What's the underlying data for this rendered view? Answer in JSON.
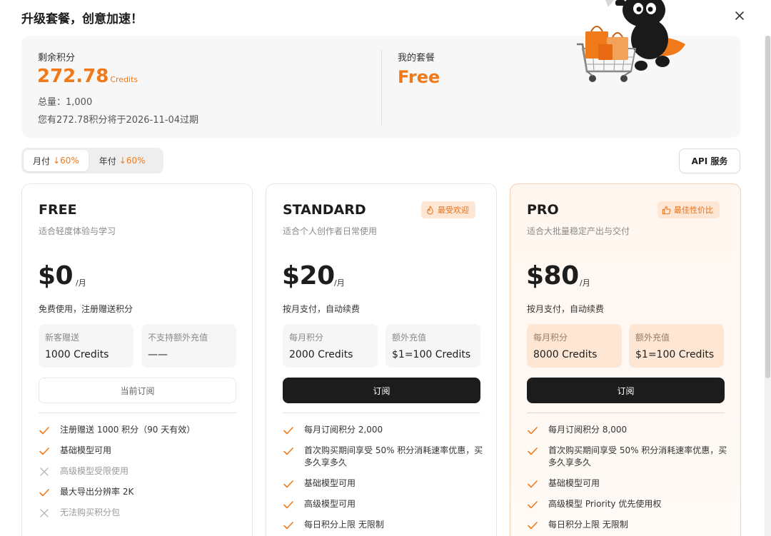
{
  "modal": {
    "title": "升级套餐，创意加速！"
  },
  "summary": {
    "remaining_label": "剩余积分",
    "remaining_value": "272.78",
    "remaining_unit": "Credits",
    "total": "总量：1,000",
    "expire": "您有272.78积分将于2026-11-04过期",
    "plan_label": "我的套餐",
    "plan_value": "Free"
  },
  "billing": {
    "options": [
      {
        "label": "月付",
        "discount": "↓60%",
        "active": true
      },
      {
        "label": "年付",
        "discount": "↓60%",
        "active": false
      }
    ]
  },
  "api_button": "API 服务",
  "colors": {
    "accent": "#f07a1a",
    "dark_button": "#1c1c1c",
    "badge_bg": "#fde6d3"
  },
  "plans": [
    {
      "name": "FREE",
      "subtitle": "适合轻度体验与学习",
      "price": "$0",
      "period": "/月",
      "pay_desc": "免费使用，注册赠送积分",
      "boxes": [
        {
          "label": "新客赠送",
          "value": "1000 Credits"
        },
        {
          "label": "不支持额外充值",
          "value": "——"
        }
      ],
      "cta": "当前订阅",
      "features": [
        {
          "text": "注册赠送 1000 积分（90 天有效）",
          "enabled": true
        },
        {
          "text": "基础模型可用",
          "enabled": true
        },
        {
          "text": "高级模型受限使用",
          "enabled": false
        },
        {
          "text": "最大导出分辨率 2K",
          "enabled": true
        },
        {
          "text": "无法购买积分包",
          "enabled": false
        }
      ]
    },
    {
      "name": "STANDARD",
      "subtitle": "适合个人创作者日常使用",
      "badge": "最受欢迎",
      "badge_icon": "flame-icon",
      "price": "$20",
      "period": "/月",
      "pay_desc": "按月支付，自动续费",
      "boxes": [
        {
          "label": "每月积分",
          "value": "2000 Credits"
        },
        {
          "label": "额外充值",
          "value": "$1=100 Credits"
        }
      ],
      "cta": "订阅",
      "features": [
        {
          "text": "每月订阅积分 2,000",
          "enabled": true
        },
        {
          "text": "首次购买期间享受 50% 积分消耗速率优惠，买多久享多久",
          "enabled": true
        },
        {
          "text": "基础模型可用",
          "enabled": true
        },
        {
          "text": "高级模型可用",
          "enabled": true
        },
        {
          "text": "每日积分上限 无限制",
          "enabled": true
        }
      ]
    },
    {
      "name": "PRO",
      "subtitle": "适合大批量稳定产出与交付",
      "badge": "最佳性价比",
      "badge_icon": "thumbs-up-icon",
      "price": "$80",
      "period": "/月",
      "pay_desc": "按月支付，自动续费",
      "boxes": [
        {
          "label": "每月积分",
          "value": "8000 Credits"
        },
        {
          "label": "额外充值",
          "value": "$1=100 Credits"
        }
      ],
      "cta": "订阅",
      "features": [
        {
          "text": "每月订阅积分 8,000",
          "enabled": true
        },
        {
          "text": "首次购买期间享受 50% 积分消耗速率优惠，买多久享多久",
          "enabled": true
        },
        {
          "text": "基础模型可用",
          "enabled": true
        },
        {
          "text": "高级模型 Priority 优先使用权",
          "enabled": true
        },
        {
          "text": "每日积分上限 无限制",
          "enabled": true
        }
      ]
    }
  ]
}
